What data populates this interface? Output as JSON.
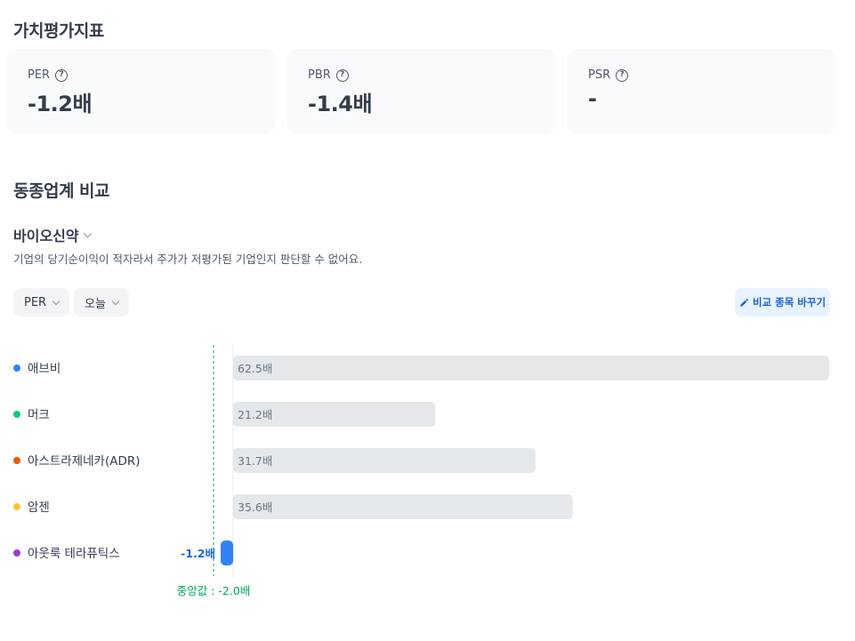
{
  "valuation": {
    "title": "가치평가지표",
    "cards": [
      {
        "label": "PER",
        "value": "-1.2배"
      },
      {
        "label": "PBR",
        "value": "-1.4배"
      },
      {
        "label": "PSR",
        "value": "-"
      }
    ]
  },
  "peer": {
    "title": "동종업계 비교",
    "sector": "바이오신약",
    "description": "기업의 당기순이익이 적자라서 주가가 저평가된 기업인지 판단할 수 없어요.",
    "metric_selector": "PER",
    "period_selector": "오늘",
    "compare_button": "비교 종목 바꾸기"
  },
  "colors": {
    "bar_gray": "#e5e8eb",
    "bar_highlight": "#3182f6",
    "median_line": "#00a661",
    "dot_abbvie": "#3182f6",
    "dot_merck": "#14c57e",
    "dot_az": "#e8590c",
    "dot_amgen": "#f7c23e",
    "dot_outlook": "#9b41cd"
  },
  "chart_data": {
    "type": "bar",
    "orientation": "horizontal",
    "categories": [
      "애브비",
      "머크",
      "아스트라제네카(ADR)",
      "암젠",
      "아웃룩 테라퓨틱스"
    ],
    "values": [
      62.5,
      21.2,
      31.7,
      35.6,
      -1.2
    ],
    "value_labels": [
      "62.5배",
      "21.2배",
      "31.7배",
      "35.6배",
      "-1.2배"
    ],
    "dot_colors": [
      "#3182f6",
      "#14c57e",
      "#e8590c",
      "#f7c23e",
      "#9b41cd"
    ],
    "highlight_index": 4,
    "median": -2.0,
    "median_label": "중앙값 : -2.0배",
    "xlim": [
      -2.0,
      62.5
    ]
  }
}
